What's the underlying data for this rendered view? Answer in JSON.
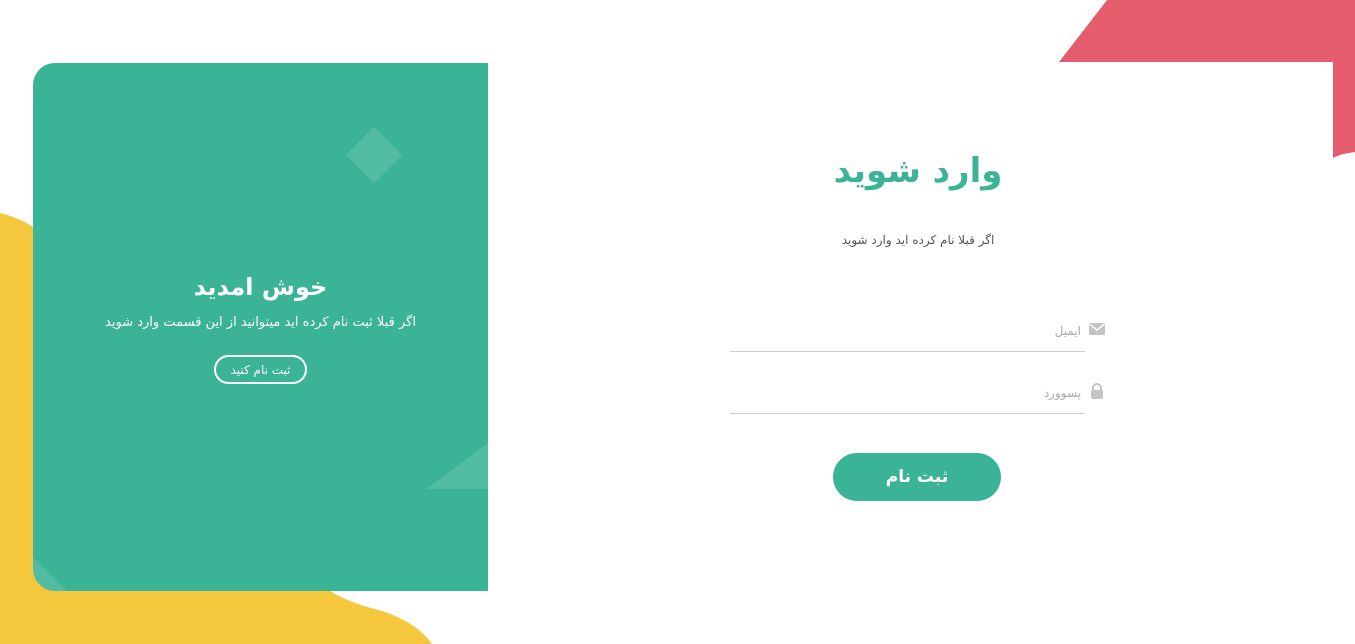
{
  "colors": {
    "accent_green": "#3bb396",
    "yellow_blob": "#f5c73d",
    "red_blob": "#e55d6c"
  },
  "welcome_panel": {
    "title": "خوش امدید",
    "text": "اگر قبلا ثبت نام کرده اید میتوانید از این قسمت وارد شوید",
    "signup_button": "ثبت نام کنید"
  },
  "login_panel": {
    "title": "وارد شوید",
    "subtitle": "اگر قبلا نام کرده اید وارد شوید",
    "email_placeholder": "ایمیل",
    "email_icon": "envelope-icon",
    "password_placeholder": "پسوورد",
    "password_icon": "lock-icon",
    "submit_button": "ثبت نام"
  }
}
